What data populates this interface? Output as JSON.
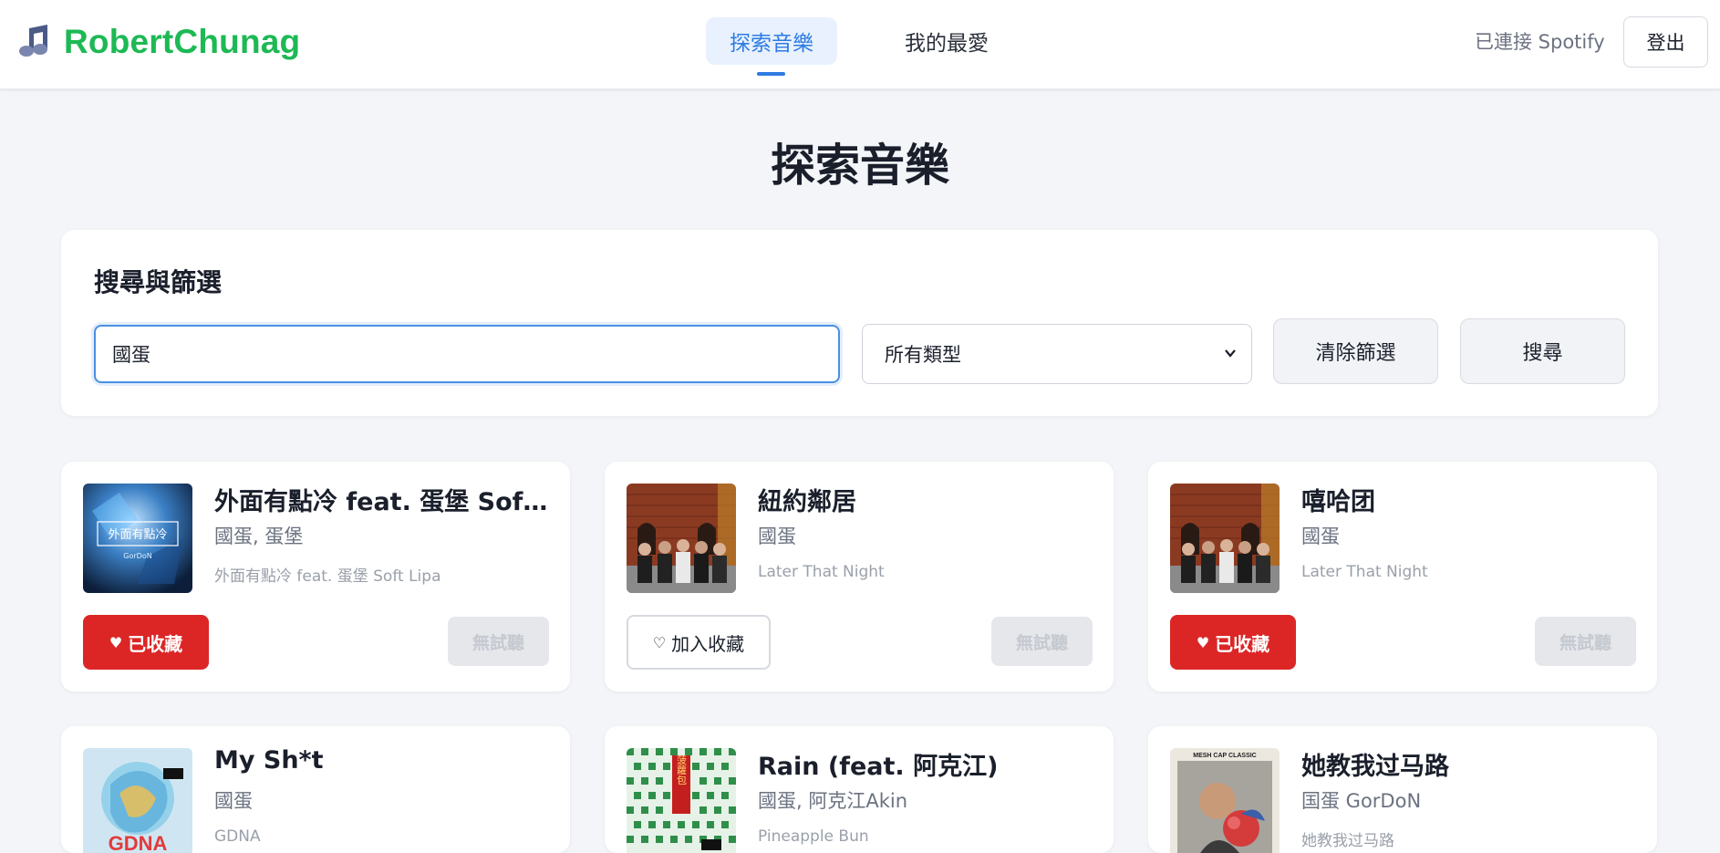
{
  "brand": {
    "name": "RobertChunag",
    "icon": "music-note-icon",
    "color": "#1db954"
  },
  "nav": {
    "tabs": [
      {
        "label": "探索音樂",
        "active": true
      },
      {
        "label": "我的最愛",
        "active": false
      }
    ],
    "spotify_status": "已連接 Spotify",
    "logout_label": "登出"
  },
  "page": {
    "title": "探索音樂"
  },
  "filter": {
    "title": "搜尋與篩選",
    "search_value": "國蛋",
    "type_selected": "所有類型",
    "clear_label": "清除篩選",
    "search_label": "搜尋"
  },
  "songs": [
    {
      "title": "外面有點冷 feat. 蛋堡 Soft ...",
      "artist": "國蛋, 蛋堡",
      "album": "外面有點冷 feat. 蛋堡 Soft Lipa",
      "fav_label": "已收藏",
      "saved": true,
      "preview_label": "無試聽",
      "cover_text": "外面有點冷",
      "cover_sub": "GorDoN"
    },
    {
      "title": "紐約鄰居",
      "artist": "國蛋",
      "album": "Later That Night",
      "fav_label": "加入收藏",
      "saved": false,
      "preview_label": "無試聽"
    },
    {
      "title": "嘻哈团",
      "artist": "國蛋",
      "album": "Later That Night",
      "fav_label": "已收藏",
      "saved": true,
      "preview_label": "無試聽"
    },
    {
      "title": "My Sh*t",
      "artist": "國蛋",
      "album": "GDNA",
      "cover_text": "GDNA"
    },
    {
      "title": "Rain (feat. 阿克江)",
      "artist": "國蛋, 阿克江Akin",
      "album": "Pineapple Bun",
      "cover_text": "菠蘿包"
    },
    {
      "title": "她教我过马路",
      "artist": "国蛋 GorDoN",
      "album": "她教我过马路",
      "cover_text": "MESH CAP CLASSIC"
    }
  ],
  "colors": {
    "accent": "#2d7be3",
    "danger": "#dc2626",
    "brand": "#1db954"
  }
}
